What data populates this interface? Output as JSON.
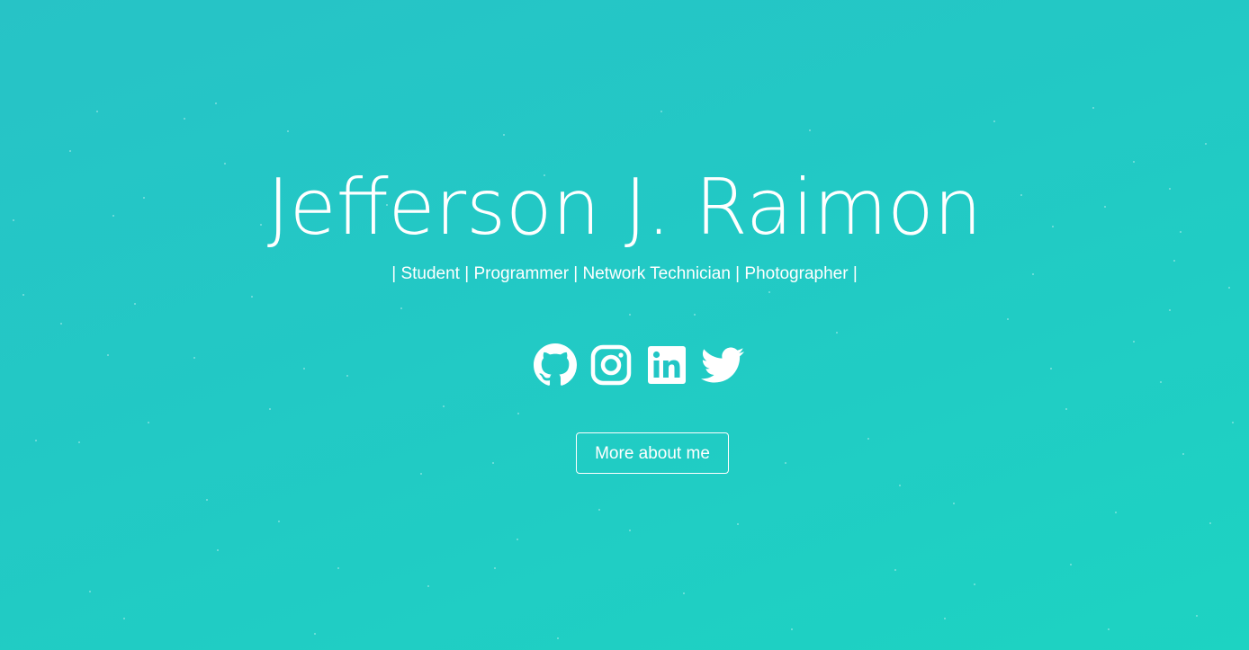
{
  "hero": {
    "name": "Jefferson J. Raimon",
    "tagline": "| Student | Programmer | Network Technician | Photographer |",
    "cta_label": "More about me",
    "colors": {
      "gradient_start": "#27c3c6",
      "gradient_end": "#1dd3c2",
      "text": "#ffffff"
    }
  },
  "socials": [
    {
      "name": "github",
      "icon": "github-icon"
    },
    {
      "name": "instagram",
      "icon": "instagram-icon"
    },
    {
      "name": "linkedin",
      "icon": "linkedin-icon"
    },
    {
      "name": "twitter",
      "icon": "twitter-icon"
    }
  ]
}
